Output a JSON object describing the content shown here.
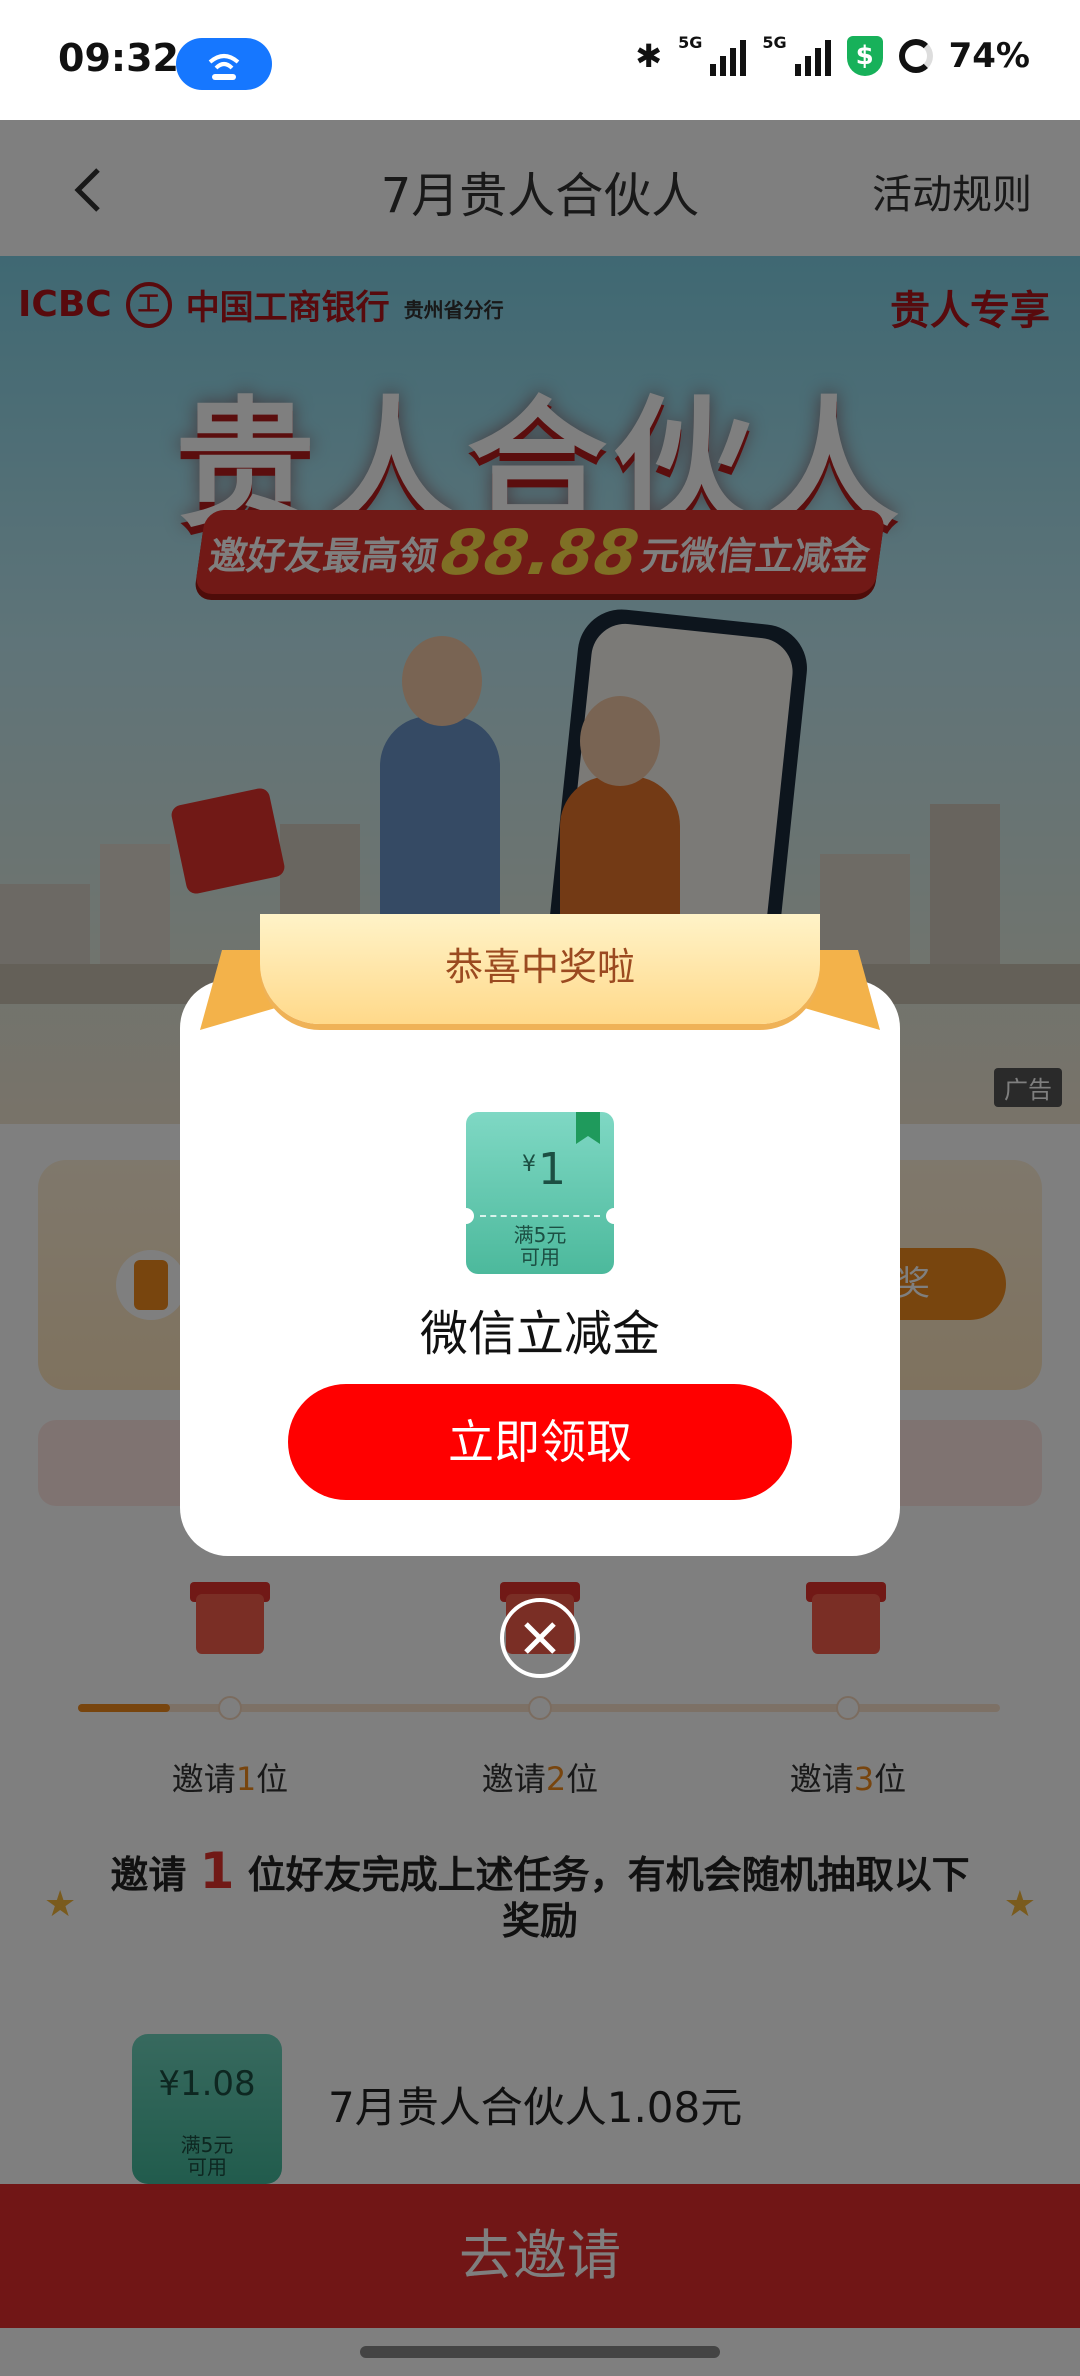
{
  "status_bar": {
    "time": "09:32",
    "net1": "5G",
    "net2": "5G",
    "battery": "74%",
    "icons": [
      "hotspot-icon",
      "bluetooth-icon",
      "signal-icon",
      "signal-icon",
      "security-shield-icon",
      "battery-ring-icon"
    ]
  },
  "header": {
    "title": "7月贵人合伙人",
    "rules_label": "活动规则"
  },
  "banner": {
    "bank_en": "ICBC",
    "bank_mark": "工",
    "bank_cn": "中国工商银行",
    "branch": "贵州省分行",
    "vip_tag": "贵人专享",
    "headline": "贵人合伙人",
    "sub_prefix": "邀好友最高领",
    "sub_amount": "88.88",
    "sub_unit": "元",
    "sub_suffix": "微信立减金",
    "ad_label": "广告"
  },
  "page": {
    "task_button": "抽奖",
    "steps": [
      {
        "pre": "邀请",
        "n": "1",
        "post": "位"
      },
      {
        "pre": "邀请",
        "n": "2",
        "post": "位"
      },
      {
        "pre": "邀请",
        "n": "3",
        "post": "位"
      }
    ],
    "progress_fraction": 0.1,
    "invite_pre": "邀请",
    "invite_n": "1",
    "invite_post": "位好友完成上述任务，有机会随机抽取以下奖励",
    "reward": {
      "value": "¥1.08",
      "cond1": "满5元",
      "cond2": "可用",
      "name": "7月贵人合伙人1.08元"
    },
    "invite_button": "去邀请"
  },
  "modal": {
    "ribbon": "恭喜中奖啦",
    "coupon_currency": "¥",
    "coupon_value": "1",
    "coupon_cond1": "满5元",
    "coupon_cond2": "可用",
    "prize_name": "微信立减金",
    "claim_button": "立即领取"
  },
  "colors": {
    "primary_red": "#ff0000",
    "brand_red": "#e22d2c",
    "accent_orange": "#f08a1c",
    "coupon_green": "#4cb99c"
  }
}
